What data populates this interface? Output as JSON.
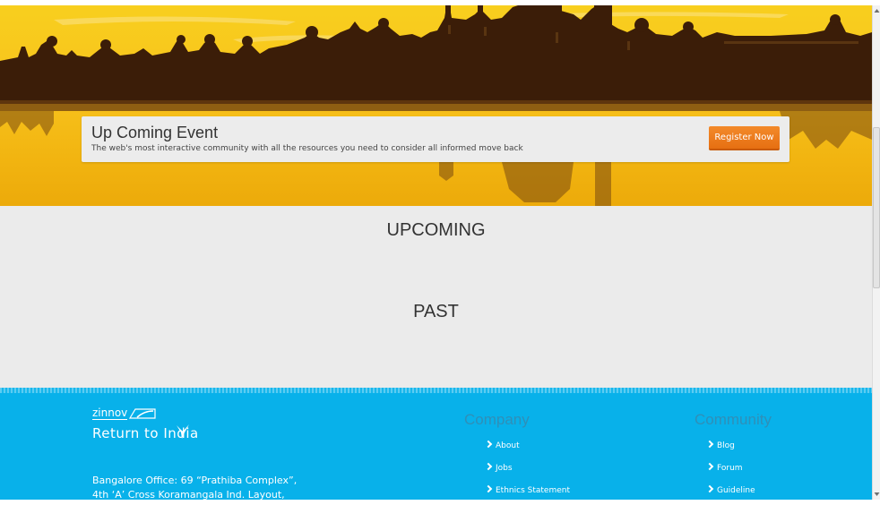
{
  "banner": {
    "event_title": "Up Coming Event",
    "event_description": "The web's most interactive community with all the resources you need to consider all informed move back",
    "register_label": "Register Now",
    "colors": {
      "sky": "#f7c21c",
      "silhouette": "#3b1d08",
      "button": "#ee7b1c"
    }
  },
  "events": {
    "upcoming_heading": "UPCOMING",
    "past_heading": "PAST"
  },
  "footer": {
    "brand_name": "zinnov",
    "brand_tagline": "Return to India",
    "address_line1": "Bangalore Office: 69 “Prathiba Complex”,",
    "address_line2": "4th ‘A’ Cross Koramangala Ind. Layout,",
    "company": {
      "heading": "Company",
      "links": [
        "About",
        "Jobs",
        "Ethnics Statement"
      ]
    },
    "community": {
      "heading": "Community",
      "links": [
        "Blog",
        "Forum",
        "Guideline"
      ]
    },
    "colors": {
      "background": "#08b1ea",
      "heading": "#2f8fb8"
    }
  },
  "icons": {
    "link_bullet": "chevron-right-icon",
    "scroll_up": "arrow-up-icon",
    "scroll_down": "arrow-down-icon",
    "brand_mark": "bird-icon"
  }
}
